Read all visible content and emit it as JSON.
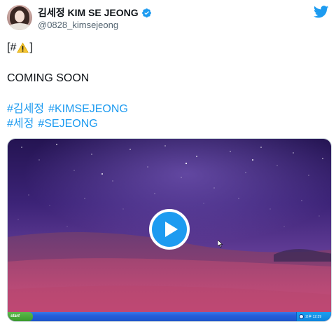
{
  "profile": {
    "display_name": "김세정 KIM SE JEONG",
    "handle": "@0828_kimsejeong"
  },
  "tweet": {
    "bracket_open": "[#",
    "bracket_close": "]",
    "coming_text": "COMING SOON",
    "hashtags_row1": [
      "#김세정",
      "#KIMSEJEONG"
    ],
    "hashtags_row2": [
      "#세정",
      "#SEJEONG"
    ]
  },
  "media": {
    "start_label": "start",
    "tray_clock": "오후 12:39"
  },
  "icons": {
    "verified": "verified-badge-icon",
    "twitter": "twitter-bird-icon",
    "warning": "warning-icon",
    "play": "play-icon"
  },
  "colors": {
    "link": "#1d9bf0",
    "verified": "#1d9bf0",
    "text": "#0f1419",
    "secondary": "#536471"
  }
}
